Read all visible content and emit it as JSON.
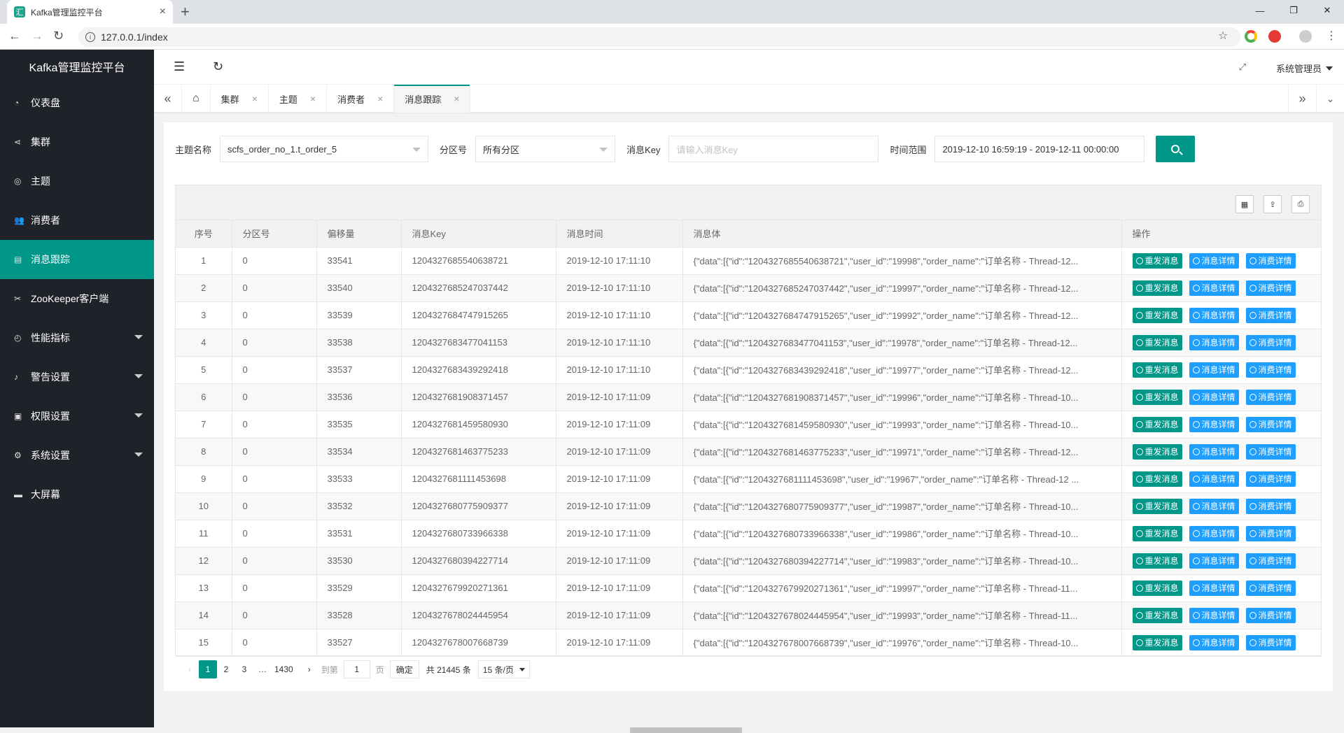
{
  "browser": {
    "tab_title": "Kafka管理监控平台",
    "tab_favicon": "汇",
    "url": "127.0.0.1/index"
  },
  "sidebar": {
    "title": "Kafka管理监控平台",
    "items": [
      {
        "label": "仪表盘",
        "icon": "dashboard-icon",
        "active": false,
        "expandable": false
      },
      {
        "label": "集群",
        "icon": "share-icon",
        "active": false,
        "expandable": false
      },
      {
        "label": "主题",
        "icon": "eye-icon",
        "active": false,
        "expandable": false
      },
      {
        "label": "消费者",
        "icon": "users-icon",
        "active": false,
        "expandable": false
      },
      {
        "label": "消息跟踪",
        "icon": "file-icon",
        "active": true,
        "expandable": false
      },
      {
        "label": "ZooKeeper客户端",
        "icon": "tools-icon",
        "active": false,
        "expandable": false
      },
      {
        "label": "性能指标",
        "icon": "gauge-icon",
        "active": false,
        "expandable": true
      },
      {
        "label": "警告设置",
        "icon": "bell-icon",
        "active": false,
        "expandable": true
      },
      {
        "label": "权限设置",
        "icon": "lock-icon",
        "active": false,
        "expandable": true
      },
      {
        "label": "系统设置",
        "icon": "gear-icon",
        "active": false,
        "expandable": true
      },
      {
        "label": "大屏幕",
        "icon": "screen-icon",
        "active": false,
        "expandable": false
      }
    ]
  },
  "header": {
    "user": "系统管理员"
  },
  "page_tabs": [
    {
      "label": "集群",
      "active": false
    },
    {
      "label": "主题",
      "active": false
    },
    {
      "label": "消费者",
      "active": false
    },
    {
      "label": "消息跟踪",
      "active": true
    }
  ],
  "filter": {
    "topic_label": "主题名称",
    "topic_value": "scfs_order_no_1.t_order_5",
    "partition_label": "分区号",
    "partition_value": "所有分区",
    "key_label": "消息Key",
    "key_placeholder": "请输入消息Key",
    "time_label": "时间范围",
    "time_value": "2019-12-10 16:59:19 - 2019-12-11 00:00:00"
  },
  "table": {
    "columns": [
      "序号",
      "分区号",
      "偏移量",
      "消息Key",
      "消息时间",
      "消息体",
      "操作"
    ],
    "actions": [
      "重发消息",
      "消息详情",
      "消费详情"
    ],
    "rows": [
      [
        "1",
        "0",
        "33541",
        "1204327685540638721",
        "2019-12-10 17:11:10",
        "{\"data\":[{\"id\":\"1204327685540638721\",\"user_id\":\"19998\",\"order_name\":\"订单名称 - Thread-12..."
      ],
      [
        "2",
        "0",
        "33540",
        "1204327685247037442",
        "2019-12-10 17:11:10",
        "{\"data\":[{\"id\":\"1204327685247037442\",\"user_id\":\"19997\",\"order_name\":\"订单名称 - Thread-12..."
      ],
      [
        "3",
        "0",
        "33539",
        "1204327684747915265",
        "2019-12-10 17:11:10",
        "{\"data\":[{\"id\":\"1204327684747915265\",\"user_id\":\"19992\",\"order_name\":\"订单名称 - Thread-12..."
      ],
      [
        "4",
        "0",
        "33538",
        "1204327683477041153",
        "2019-12-10 17:11:10",
        "{\"data\":[{\"id\":\"1204327683477041153\",\"user_id\":\"19978\",\"order_name\":\"订单名称 - Thread-12..."
      ],
      [
        "5",
        "0",
        "33537",
        "1204327683439292418",
        "2019-12-10 17:11:10",
        "{\"data\":[{\"id\":\"1204327683439292418\",\"user_id\":\"19977\",\"order_name\":\"订单名称 - Thread-12..."
      ],
      [
        "6",
        "0",
        "33536",
        "1204327681908371457",
        "2019-12-10 17:11:09",
        "{\"data\":[{\"id\":\"1204327681908371457\",\"user_id\":\"19996\",\"order_name\":\"订单名称 - Thread-10..."
      ],
      [
        "7",
        "0",
        "33535",
        "1204327681459580930",
        "2019-12-10 17:11:09",
        "{\"data\":[{\"id\":\"1204327681459580930\",\"user_id\":\"19993\",\"order_name\":\"订单名称 - Thread-10..."
      ],
      [
        "8",
        "0",
        "33534",
        "1204327681463775233",
        "2019-12-10 17:11:09",
        "{\"data\":[{\"id\":\"1204327681463775233\",\"user_id\":\"19971\",\"order_name\":\"订单名称 - Thread-12..."
      ],
      [
        "9",
        "0",
        "33533",
        "1204327681111453698",
        "2019-12-10 17:11:09",
        "{\"data\":[{\"id\":\"1204327681111453698\",\"user_id\":\"19967\",\"order_name\":\"订单名称 - Thread-12 ..."
      ],
      [
        "10",
        "0",
        "33532",
        "1204327680775909377",
        "2019-12-10 17:11:09",
        "{\"data\":[{\"id\":\"1204327680775909377\",\"user_id\":\"19987\",\"order_name\":\"订单名称 - Thread-10..."
      ],
      [
        "11",
        "0",
        "33531",
        "1204327680733966338",
        "2019-12-10 17:11:09",
        "{\"data\":[{\"id\":\"1204327680733966338\",\"user_id\":\"19986\",\"order_name\":\"订单名称 - Thread-10..."
      ],
      [
        "12",
        "0",
        "33530",
        "1204327680394227714",
        "2019-12-10 17:11:09",
        "{\"data\":[{\"id\":\"1204327680394227714\",\"user_id\":\"19983\",\"order_name\":\"订单名称 - Thread-10..."
      ],
      [
        "13",
        "0",
        "33529",
        "1204327679920271361",
        "2019-12-10 17:11:09",
        "{\"data\":[{\"id\":\"1204327679920271361\",\"user_id\":\"19997\",\"order_name\":\"订单名称 - Thread-11..."
      ],
      [
        "14",
        "0",
        "33528",
        "1204327678024445954",
        "2019-12-10 17:11:09",
        "{\"data\":[{\"id\":\"1204327678024445954\",\"user_id\":\"19993\",\"order_name\":\"订单名称 - Thread-11..."
      ],
      [
        "15",
        "0",
        "33527",
        "1204327678007668739",
        "2019-12-10 17:11:09",
        "{\"data\":[{\"id\":\"1204327678007668739\",\"user_id\":\"19976\",\"order_name\":\"订单名称 - Thread-10..."
      ]
    ]
  },
  "pager": {
    "prev": "‹",
    "pages": [
      "1",
      "2",
      "3"
    ],
    "ellipsis": "…",
    "last": "1430",
    "next": "›",
    "goto_label": "到第",
    "goto_value": "1",
    "page_unit": "页",
    "confirm": "确定",
    "total": "共 21445 条",
    "page_size": "15 条/页"
  },
  "colors": {
    "accent": "#009688",
    "info": "#1e9fff",
    "sidebar_bg": "#20222a"
  }
}
